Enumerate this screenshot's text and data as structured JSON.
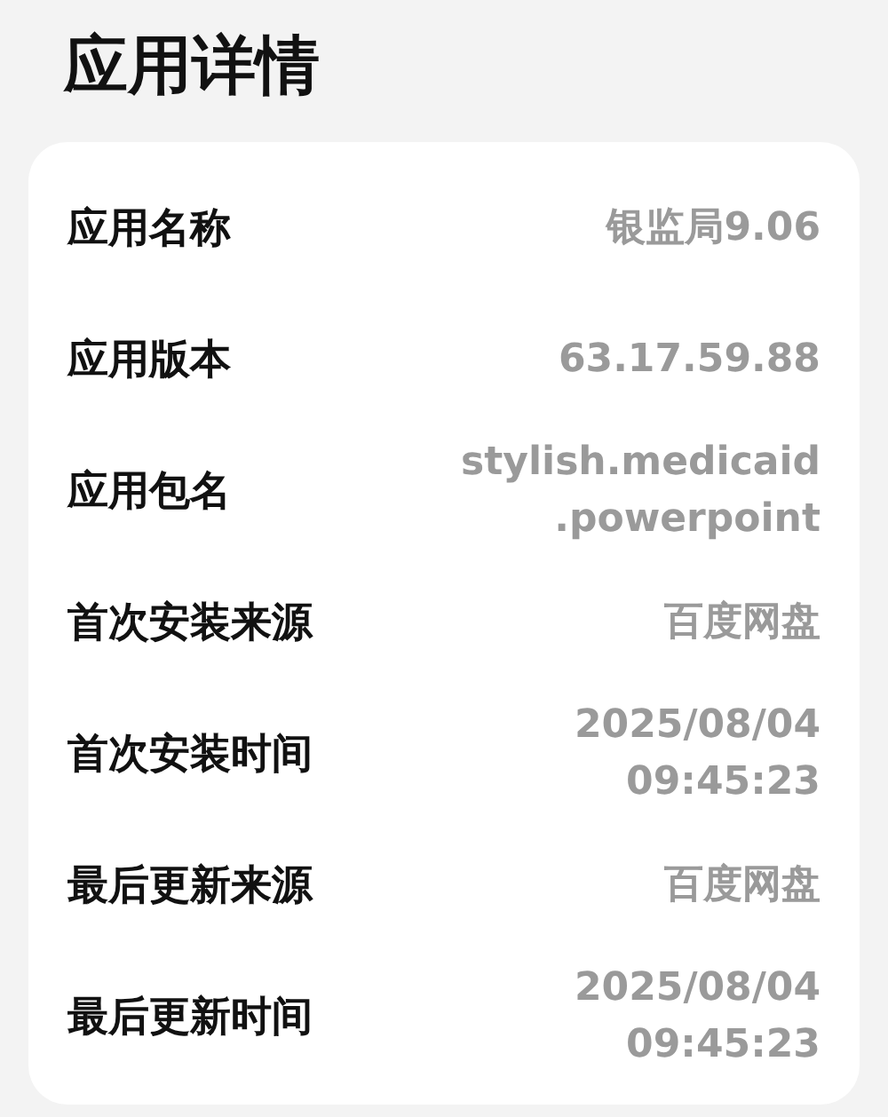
{
  "title": "应用详情",
  "rows": [
    {
      "label": "应用名称",
      "value_lines": [
        "银监局9.06"
      ]
    },
    {
      "label": "应用版本",
      "value_lines": [
        "63.17.59.88"
      ]
    },
    {
      "label": "应用包名",
      "value_lines": [
        "stylish.medicaid",
        ".powerpoint"
      ]
    },
    {
      "label": "首次安装来源",
      "value_lines": [
        "百度网盘"
      ]
    },
    {
      "label": "首次安装时间",
      "value_lines": [
        "2025/08/04",
        "09:45:23"
      ]
    },
    {
      "label": "最后更新来源",
      "value_lines": [
        "百度网盘"
      ]
    },
    {
      "label": "最后更新时间",
      "value_lines": [
        "2025/08/04",
        "09:45:23"
      ]
    }
  ]
}
